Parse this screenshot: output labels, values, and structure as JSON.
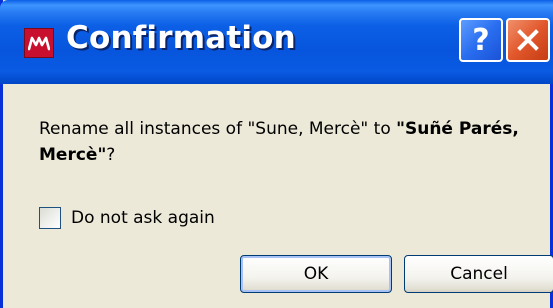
{
  "window": {
    "title": "Confirmation",
    "help_glyph": "?",
    "colors": {
      "titlebar": "#0755dd",
      "body": "#ece9d8",
      "close": "#e2582c",
      "app_icon": "#c8102e"
    }
  },
  "message": {
    "prefix": "Rename all instances of \"Sune, Mercè\" to ",
    "new_name": "\"Suñé Parés, Mercè\"",
    "suffix": "?"
  },
  "checkbox": {
    "label": "Do not ask again",
    "checked": false
  },
  "buttons": {
    "ok": "OK",
    "cancel": "Cancel"
  },
  "icons": {
    "app": "app-logo-icon",
    "help": "help-icon",
    "close": "close-icon"
  }
}
